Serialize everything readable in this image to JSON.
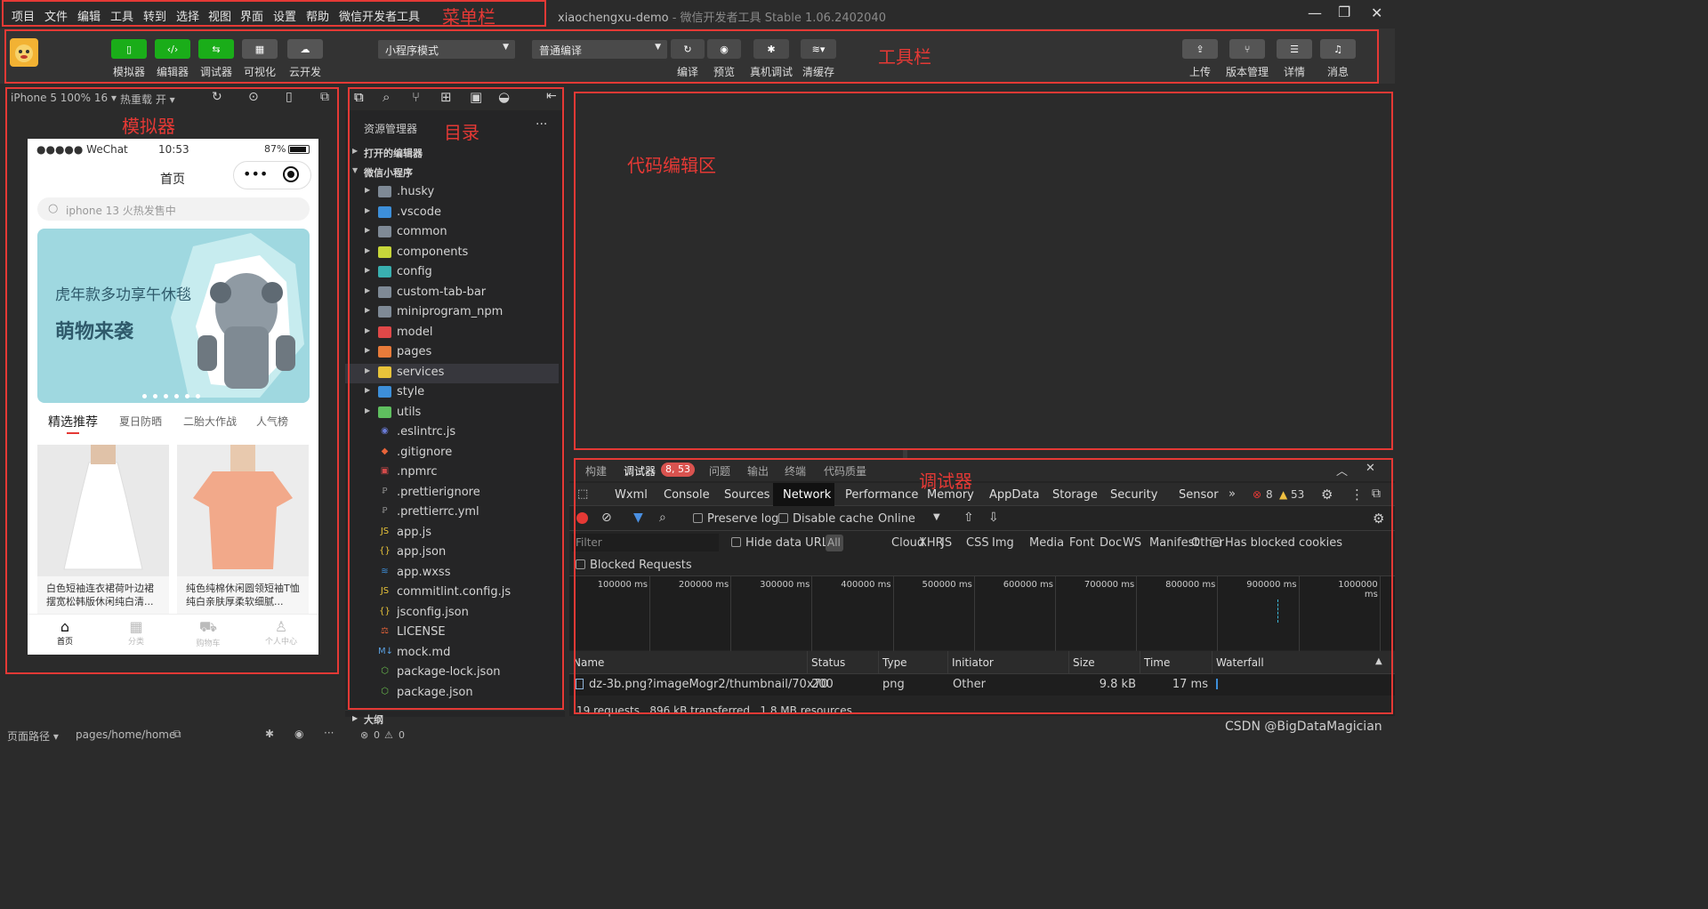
{
  "menu": [
    "项目",
    "文件",
    "编辑",
    "工具",
    "转到",
    "选择",
    "视图",
    "界面",
    "设置",
    "帮助",
    "微信开发者工具"
  ],
  "window": {
    "project": "xiaochengxu-demo",
    "app": "- 微信开发者工具 Stable 1.06.2402040"
  },
  "annotations": {
    "menubar": "菜单栏",
    "toolbar": "工具栏",
    "simulator": "模拟器",
    "directory": "目录",
    "editor": "代码编辑区",
    "debugger": "调试器"
  },
  "toolbar": {
    "left_buttons": [
      "模拟器",
      "编辑器",
      "调试器",
      "可视化",
      "云开发"
    ],
    "mode_select": "小程序模式",
    "compile_select": "普通编译",
    "actions": [
      "编译",
      "预览",
      "真机调试",
      "清缓存"
    ],
    "right_buttons": [
      "上传",
      "版本管理",
      "详情",
      "消息"
    ]
  },
  "simulator": {
    "device": "iPhone 5 100% 16 ▾",
    "hot_reload": "热重载 开 ▾",
    "status_carrier": "●●●●● WeChat",
    "status_time": "10:53",
    "status_battery": "87%",
    "nav_title": "首页",
    "search_placeholder": "iphone 13 火热发售中",
    "banner_line1": "虎年款多功享午休毯",
    "banner_line2": "萌物来袭",
    "tabs": [
      "精选推荐",
      "夏日防晒",
      "二胎大作战",
      "人气榜"
    ],
    "products": [
      {
        "title": "白色短袖连衣裙荷叶边裙摆宽松韩版休闲纯白清..."
      },
      {
        "title": "纯色纯棉休闲圆领短袖T恤纯白亲肤厚柔软细腻..."
      }
    ],
    "tabbar": [
      "首页",
      "分类",
      "购物车",
      "个人中心"
    ]
  },
  "explorer": {
    "title": "资源管理器",
    "more": "···",
    "sections": [
      "打开的编辑器",
      "微信小程序"
    ],
    "folders": [
      ".husky",
      ".vscode",
      "common",
      "components",
      "config",
      "custom-tab-bar",
      "miniprogram_npm",
      "model",
      "pages",
      "services",
      "style",
      "utils"
    ],
    "files": [
      ".eslintrc.js",
      ".gitignore",
      ".npmrc",
      ".prettierignore",
      ".prettierrc.yml",
      "app.js",
      "app.json",
      "app.wxss",
      "commitlint.config.js",
      "jsconfig.json",
      "LICENSE",
      "mock.md",
      "package-lock.json",
      "package.json"
    ],
    "outline": "大纲"
  },
  "debugger": {
    "top_tabs": [
      "构建",
      "调试器",
      "问题",
      "输出",
      "终端",
      "代码质量"
    ],
    "badge": "8, 53",
    "devtabs": [
      "Wxml",
      "Console",
      "Sources",
      "Network",
      "Performance",
      "Memory",
      "AppData",
      "Storage",
      "Security",
      "Sensor"
    ],
    "error_count": "8",
    "warn_count": "53",
    "preserve_log": "Preserve log",
    "disable_cache": "Disable cache",
    "throttle": "Online",
    "filter_placeholder": "Filter",
    "hide_data_urls": "Hide data URLs",
    "types": [
      "All",
      "Cloud",
      "XHR",
      "JS",
      "CSS",
      "Img",
      "Media",
      "Font",
      "Doc",
      "WS",
      "Manifest",
      "Other"
    ],
    "has_blocked": "Has blocked cookies",
    "blocked_requests": "Blocked Requests",
    "timeline_ticks": [
      "100000 ms",
      "200000 ms",
      "300000 ms",
      "400000 ms",
      "500000 ms",
      "600000 ms",
      "700000 ms",
      "800000 ms",
      "900000 ms",
      "1000000 ms"
    ],
    "columns": [
      "Name",
      "Status",
      "Type",
      "Initiator",
      "Size",
      "Time",
      "Waterfall"
    ],
    "row": {
      "name": "dz-3b.png?imageMogr2/thumbnail/70x70",
      "status": "200",
      "type": "png",
      "initiator": "Other",
      "size": "9.8 kB",
      "time": "17 ms"
    },
    "summary": "19 requests   896 kB transferred   1.8 MB resources"
  },
  "status": {
    "path_label": "页面路径 ▾",
    "path": "pages/home/home",
    "errors": "0",
    "warnings": "0",
    "watermark": "CSDN @BigDataMagician"
  }
}
